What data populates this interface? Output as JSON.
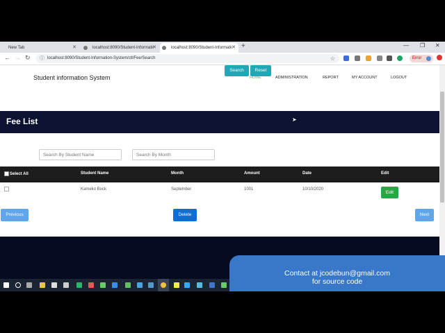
{
  "browser": {
    "tabs": [
      {
        "title": "New Tab"
      },
      {
        "title": "localhost:8090/Student-Information"
      },
      {
        "title": "localhost:8090/Student-Information"
      }
    ],
    "url": "localhost:8090/Student-Information-System/ctl/Fee/Search",
    "error_label": "Error"
  },
  "site": {
    "brand": "Student information System",
    "nav": [
      "HOME",
      "ADMINISTRATION",
      "REPORT",
      "MY ACCOUNT",
      "LOGOUT"
    ],
    "active_nav": "HOME"
  },
  "banner": {
    "title": "Fee List"
  },
  "filters": {
    "name_placeholder": "Search By Student Name",
    "month_placeholder": "Search By Month",
    "search_label": "Search",
    "reset_label": "Reset"
  },
  "table": {
    "select_all_label": "Select All",
    "headers": [
      "Student Name",
      "Month",
      "Amount",
      "Date",
      "Edit"
    ],
    "rows": [
      {
        "name": "Kameko Buck",
        "month": "September",
        "amount": "1001",
        "date": "10/10/2020",
        "edit_label": "Edit"
      }
    ]
  },
  "pager": {
    "previous": "Previous",
    "delete": "Delete",
    "next": "Next"
  },
  "overlay": {
    "line1": "Contact at jcodebun@gmail.com",
    "line2": "for source code"
  },
  "colors": {
    "banner": "#0b1331",
    "teal": "#20a8b6",
    "edit": "#28a745",
    "pager": "#61a6e8",
    "delete": "#0d6fd6",
    "active_nav": "#5cb85c"
  }
}
